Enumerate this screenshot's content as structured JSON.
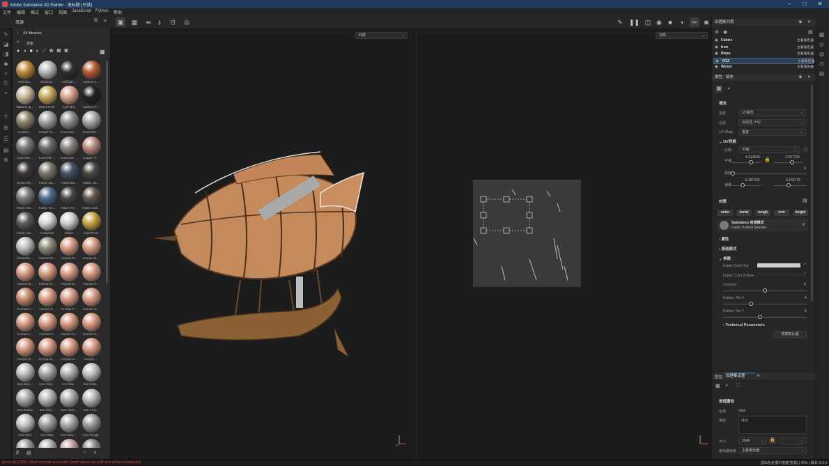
{
  "window": {
    "title": "Adobe Substance 3D Painter - 无标题 (只读)"
  },
  "menu": [
    "文件",
    "编辑",
    "模式",
    "窗口",
    "视图",
    "JavaScript",
    "Python",
    "帮助"
  ],
  "assets": {
    "title": "资源",
    "breadcrumb": "All libraries",
    "search_placeholder": "搜索",
    "materials": [
      {
        "label": "Aluminiu...",
        "color": "#c08a3a"
      },
      {
        "label": "Aluminiu...",
        "color": "#b9b9b9"
      },
      {
        "label": "Artificial ...",
        "color": "#2e2e2e"
      },
      {
        "label": "Autumn L...",
        "color": "#b35a34"
      },
      {
        "label": "Baked Lig...",
        "color": "#c9b79a"
      },
      {
        "label": "Brass Pure",
        "color": "#c7a95a"
      },
      {
        "label": "Calf Skin",
        "color": "#d9a28a"
      },
      {
        "label": "Carbon Fi...",
        "color": "#222222"
      },
      {
        "label": "Coated ...",
        "color": "#8c8468"
      },
      {
        "label": "Cobalt Pu...",
        "color": "#a3a3a3"
      },
      {
        "label": "Concrete ...",
        "color": "#8e8e8e"
      },
      {
        "label": "Concrete ...",
        "color": "#a8a8a8"
      },
      {
        "label": "Concrete ...",
        "color": "#7a7a7a"
      },
      {
        "label": "Concrete ...",
        "color": "#6b6b6b"
      },
      {
        "label": "Concrete ...",
        "color": "#8a857c"
      },
      {
        "label": "Copper P...",
        "color": "#b98a7e"
      },
      {
        "label": "Denim Ri...",
        "color": "#3a3633"
      },
      {
        "label": "Fabric Ba...",
        "color": "#7c7768"
      },
      {
        "label": "Fabric Ba...",
        "color": "#3f5468"
      },
      {
        "label": "Fabric De...",
        "color": "#4b4640"
      },
      {
        "label": "Fabric Kni...",
        "color": "#7a7a7a"
      },
      {
        "label": "Fabric Ro...",
        "color": "#4f6b87"
      },
      {
        "label": "Fabric Ro...",
        "color": "#444444"
      },
      {
        "label": "Fabric Sof...",
        "color": "#5f564c"
      },
      {
        "label": "Fabric Sui...",
        "color": "#5a5a5a"
      },
      {
        "label": "Footprints",
        "color": "#d8d8d8"
      },
      {
        "label": "Glitter",
        "color": "#cfcfcf"
      },
      {
        "label": "Gold Pure",
        "color": "#c9a43e"
      },
      {
        "label": "Gouache ...",
        "color": "#bcbcbc"
      },
      {
        "label": "Ground G...",
        "color": "#8b8a79"
      },
      {
        "label": "Human B...",
        "color": "#d79a82"
      },
      {
        "label": "Human B...",
        "color": "#d79a82"
      },
      {
        "label": "Human B...",
        "color": "#d79a82"
      },
      {
        "label": "Human C...",
        "color": "#d79a82"
      },
      {
        "label": "Human E...",
        "color": "#d79a82"
      },
      {
        "label": "Human F...",
        "color": "#d79a82"
      },
      {
        "label": "Human F...",
        "color": "#c9876a"
      },
      {
        "label": "Human F...",
        "color": "#d79a82"
      },
      {
        "label": "Human F...",
        "color": "#d79a82"
      },
      {
        "label": "Human H...",
        "color": "#d79a82"
      },
      {
        "label": "Human L...",
        "color": "#d79a82"
      },
      {
        "label": "Human F...",
        "color": "#d79a82"
      },
      {
        "label": "Human N...",
        "color": "#d79a82"
      },
      {
        "label": "Human N...",
        "color": "#d79a82"
      },
      {
        "label": "Human N...",
        "color": "#d79a82"
      },
      {
        "label": "Human N...",
        "color": "#d79a82"
      },
      {
        "label": "Human S...",
        "color": "#d79a82"
      },
      {
        "label": "Human ...",
        "color": "#d79a82"
      },
      {
        "label": "Iron Brus...",
        "color": "#bdbdbd"
      },
      {
        "label": "Iron Chai...",
        "color": "#a5a5a5"
      },
      {
        "label": "Iron Dia...",
        "color": "#b0b0b0"
      },
      {
        "label": "Iron Galv...",
        "color": "#c0c0c0"
      },
      {
        "label": "Iron Grainy",
        "color": "#a8a8a8"
      },
      {
        "label": "Iron Grin...",
        "color": "#b5b5b5"
      },
      {
        "label": "Iron Ham...",
        "color": "#acacac"
      },
      {
        "label": "Iron Pow...",
        "color": "#b8b8b8"
      },
      {
        "label": "Iron Pure",
        "color": "#c4c4c4"
      },
      {
        "label": "Iron Raw",
        "color": "#9e9e9e"
      },
      {
        "label": "Iron Raw ...",
        "color": "#a9a9a9"
      },
      {
        "label": "Iron Rough",
        "color": "#989898"
      },
      {
        "label": "",
        "color": "#9a9a9a"
      },
      {
        "label": "",
        "color": "#b0b0b0"
      },
      {
        "label": "",
        "color": "#c9a0a0"
      },
      {
        "label": "",
        "color": "#8a8a8a"
      }
    ]
  },
  "viewport": {
    "left_mode": "材质",
    "right_mode": "材质"
  },
  "texture_sets": {
    "title": "纹理集列表",
    "items": [
      {
        "name": "Fabric",
        "shader": "主着着色器"
      },
      {
        "name": "Iron",
        "shader": "主着着色器"
      },
      {
        "name": "Rope",
        "shader": "主着着色器"
      },
      {
        "name": "VG2",
        "shader": "主着着色器"
      },
      {
        "name": "Wood",
        "shader": "主着着色器"
      }
    ]
  },
  "properties": {
    "title": "属性 - 填充",
    "fill_section": "填充",
    "projection_label": "投影",
    "projection_value": "UV投影",
    "filter_label": "过滤",
    "filter_value": "双线性 | HQ",
    "uvwrap_label": "UV Wrap",
    "uvwrap_value": "重复",
    "uvtransform_section": "UV转换",
    "scale_label": "比例",
    "scale_mode": "平铺",
    "tile_label": "平铺",
    "tile_x": "4.313639",
    "tile_y": "3.557740",
    "rotation_label": "旋转",
    "rotation_value": "0",
    "offset_label": "偏移",
    "offset_x": "-0.187405",
    "offset_y": "0.166776",
    "material_section": "材质",
    "channels": [
      "color",
      "metal",
      "rough",
      "nrm",
      "height"
    ],
    "substance_mode": "Substance 材质模式",
    "substance_name": "Fabric Knitted Sweater",
    "attributes_label": "属性",
    "input_label": "源选模式",
    "params_label": "参数",
    "fabric_color_top": "Fabric Color Top",
    "fabric_color_bottom": "Fabric Color Bottom",
    "contrast_label": "Contrast",
    "contrast_value": "0",
    "pattern_x_label": "Pattern Tile X",
    "pattern_x_value": "4",
    "pattern_y_label": "Pattern Tile Y",
    "pattern_y_value": "5",
    "tech_params": "Technical Parameters",
    "reset_button": "恢复默认值"
  },
  "layers_panel": {
    "tab_layers": "图层",
    "tab_textureset_settings": "纹理集设置",
    "general_props": "常规属性",
    "name_label": "名称",
    "name_value": "VG2",
    "desc_label": "描述",
    "desc_value": "描述",
    "size_label": "大小",
    "size_value": "2048",
    "shader_label": "着色器链接",
    "shader_value": "主着着色器"
  },
  "status": {
    "warning": "[Error 3D] [FBX] | Mesh normals are invalid (some values are null) and will be recomputed",
    "right": "透出包处理中进度(完成) | 40% | 版本: 8.3.0"
  },
  "colors": {
    "accent": "#1e3a5c",
    "warning": "#e0443a",
    "panel": "#262626"
  }
}
